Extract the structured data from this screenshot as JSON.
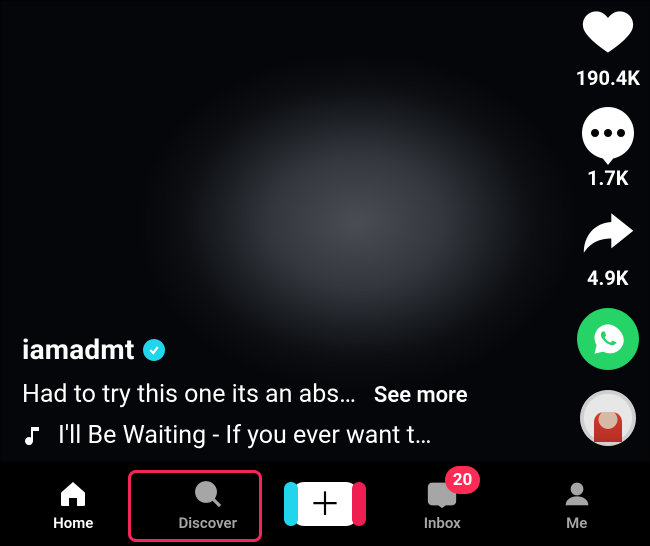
{
  "user": {
    "username": "iamadmt",
    "verified": true
  },
  "caption": {
    "text": "Had to try this one its an abs…",
    "more_label": "See more"
  },
  "sound": {
    "text": "I'll Be Waiting - If you ever want t…"
  },
  "rail": {
    "likes": "190.4K",
    "comments": "1.7K",
    "shares": "4.9K"
  },
  "nav": {
    "home": "Home",
    "discover": "Discover",
    "inbox": "Inbox",
    "me": "Me",
    "inbox_badge": "20"
  },
  "colors": {
    "accent_pink": "#fe2c55",
    "accent_cyan": "#20d5ec",
    "whatsapp": "#25D366"
  }
}
